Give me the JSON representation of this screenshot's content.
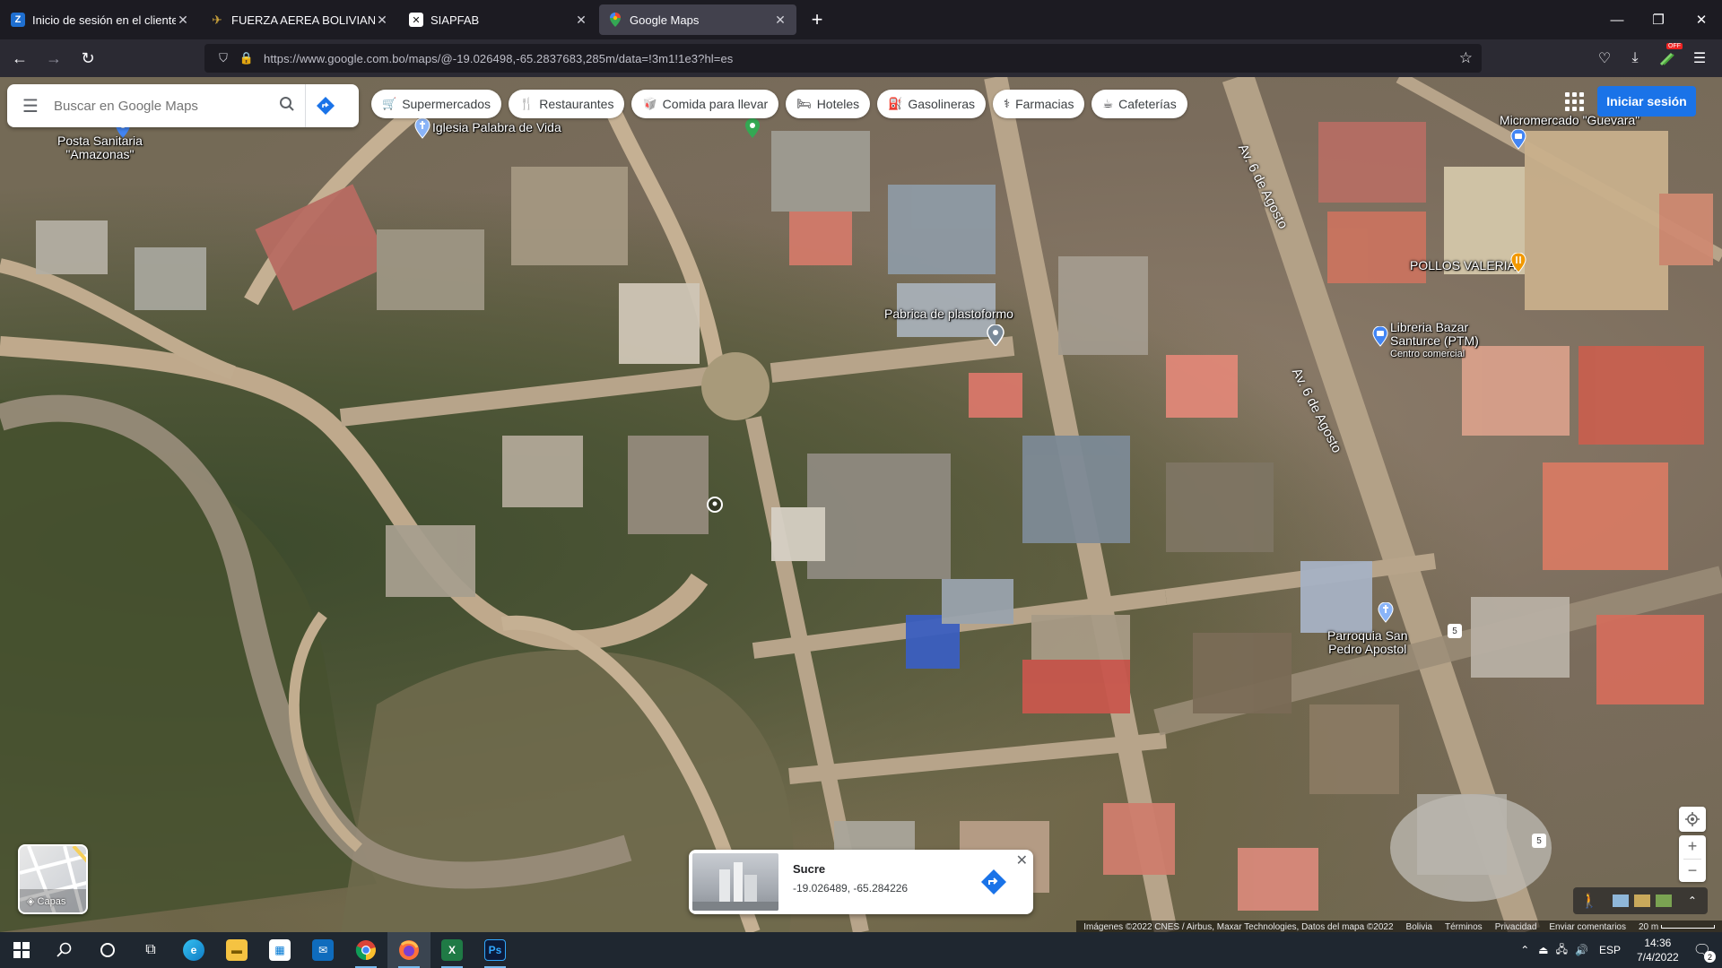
{
  "browser": {
    "tabs": [
      {
        "title": "Inicio de sesión en el cliente web",
        "favicon": "Z",
        "favicon_color": "#1f6fd0",
        "active": false
      },
      {
        "title": "FUERZA AEREA BOLIVIANA",
        "favicon": "✈",
        "favicon_color": "#c9a13b",
        "active": false
      },
      {
        "title": "SIAPFAB",
        "favicon": "✕",
        "favicon_color": "#ffffff",
        "active": false
      },
      {
        "title": "Google Maps",
        "favicon": "◉",
        "favicon_color": "#34a853",
        "active": true
      }
    ],
    "url": "https://www.google.com.bo/maps/@-19.026498,-65.2837683,285m/data=!3m1!1e3?hl=es",
    "off_badge": "OFF"
  },
  "maps": {
    "search_placeholder": "Buscar en Google Maps",
    "chips": [
      {
        "label": "Supermercados",
        "icon": "cart-icon",
        "glyph": "🛒"
      },
      {
        "label": "Restaurantes",
        "icon": "fork-knife-icon",
        "glyph": "🍴"
      },
      {
        "label": "Comida para llevar",
        "icon": "takeout-icon",
        "glyph": "🥡"
      },
      {
        "label": "Hoteles",
        "icon": "bed-icon",
        "glyph": "🛏"
      },
      {
        "label": "Gasolineras",
        "icon": "gas-pump-icon",
        "glyph": "⛽"
      },
      {
        "label": "Farmacias",
        "icon": "pharmacy-icon",
        "glyph": "⚕"
      },
      {
        "label": "Cafeterías",
        "icon": "coffee-icon",
        "glyph": "☕"
      }
    ],
    "signin_label": "Iniciar sesión",
    "layers_label": "Capas",
    "places": [
      {
        "name": "Posta Sanitaria \"Amazonas\"",
        "line1": "Posta Sanitaria",
        "line2": "\"Amazonas\"",
        "color": "#4285f4"
      },
      {
        "name": "Iglesia Palabra de Vida",
        "color": "#8ab4f8"
      },
      {
        "name": "Pabrica de plastoformo",
        "color": "#7a8a99"
      },
      {
        "name": "Micromercado \"Guevara\"",
        "color": "#4285f4"
      },
      {
        "name": "POLLOS VALERIA",
        "color": "#f29900"
      },
      {
        "name": "Libreria Bazar Santurce (PTM)",
        "line1": "Libreria Bazar",
        "line2": "Santurce (PTM)",
        "sub": "Centro comercial",
        "color": "#4285f4"
      },
      {
        "name": "Parroquia San Pedro Apostol",
        "line1": "Parroquia San",
        "line2": "Pedro Apostol",
        "color": "#8ab4f8"
      }
    ],
    "streets": [
      "Av. 6 de Agosto",
      "Av. 6 de Agosto"
    ],
    "route_badges": [
      "5",
      "5"
    ],
    "info_card": {
      "title": "Sucre",
      "coords": "-19.026489, -65.284226"
    },
    "attribution": {
      "imagery": "Imágenes ©2022 CNES / Airbus, Maxar Technologies, Datos del mapa ©2022",
      "country": "Bolivia",
      "terms": "Términos",
      "privacy": "Privacidad",
      "feedback": "Enviar comentarios",
      "scale": "20 m"
    }
  },
  "taskbar": {
    "apps": [
      "windows-start",
      "search",
      "cortana",
      "task-view",
      "edge",
      "file-explorer",
      "store",
      "mail",
      "chrome",
      "firefox",
      "excel",
      "photoshop"
    ],
    "language": "ESP",
    "time": "14:36",
    "date": "7/4/2022",
    "notifications": "2"
  }
}
